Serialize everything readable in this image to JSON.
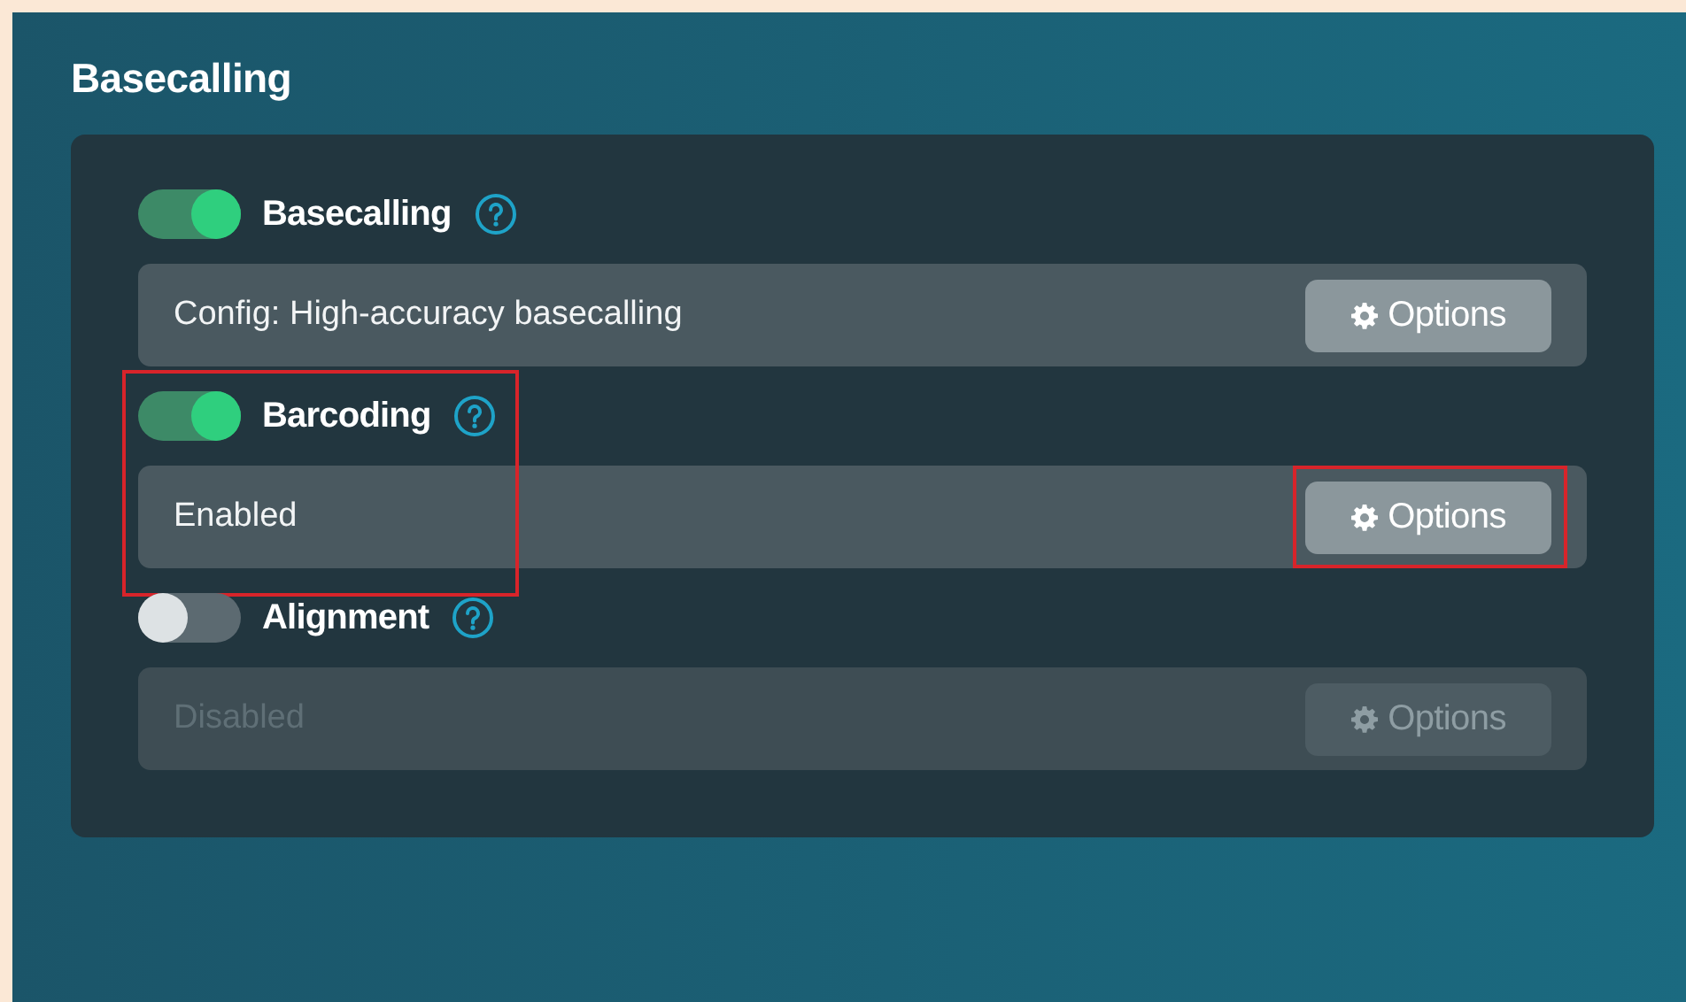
{
  "title": "Basecalling",
  "sections": [
    {
      "label": "Basecalling",
      "on": true,
      "status": "Config: High-accuracy basecalling",
      "disabled": false,
      "button": "Options",
      "highlighted": false,
      "button_highlighted": false
    },
    {
      "label": "Barcoding",
      "on": true,
      "status": "Enabled",
      "disabled": false,
      "button": "Options",
      "highlighted": true,
      "button_highlighted": true
    },
    {
      "label": "Alignment",
      "on": false,
      "status": "Disabled",
      "disabled": true,
      "button": "Options",
      "highlighted": false,
      "button_highlighted": false
    }
  ]
}
